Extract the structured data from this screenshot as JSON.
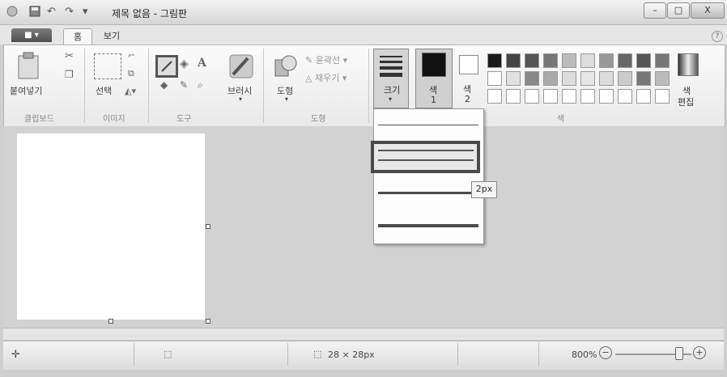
{
  "window": {
    "title": "제목 없음 - 그림판",
    "minimize": "–",
    "maximize": "□",
    "close": "X",
    "qat_undo": "↶",
    "qat_redo": "↷",
    "qat_menu": "▾"
  },
  "tabs": [
    {
      "label": "홈"
    },
    {
      "label": "보기"
    }
  ],
  "file_menu": "■ ▾",
  "help_icon": "?",
  "ribbon": {
    "clipboard": {
      "paste": "붙여넣기",
      "group": "클립보드"
    },
    "image": {
      "select": "선택",
      "group": "이미지"
    },
    "tools": {
      "group": "도구",
      "text_tool": "A"
    },
    "brushes": {
      "label": "브러시"
    },
    "shapes": {
      "label": "도형",
      "outline": "윤곽선",
      "fill": "채우기",
      "group": "도형"
    },
    "size": {
      "label": "크기"
    },
    "color1": {
      "label": "색",
      "num": "1"
    },
    "color2": {
      "label": "색",
      "num": "2"
    },
    "edit_colors": {
      "label1": "색",
      "label2": "편집"
    },
    "colors_group": "색"
  },
  "size_dropdown": {
    "tooltip": "2px",
    "options": [
      "1px",
      "2px",
      "3px",
      "5px"
    ],
    "selected": "2px"
  },
  "status": {
    "canvas_size": "28 × 28px",
    "zoom": "800%",
    "zoom_out": "−",
    "zoom_in": "+"
  },
  "palette_row1": [
    "#1a1a1a",
    "#444444",
    "#555555",
    "#777777",
    "#bbbbbb",
    "#dddddd",
    "#999999",
    "#666666",
    "#555555",
    "#777777"
  ],
  "palette_row2": [
    "#ffffff",
    "#e0e0e0",
    "#888888",
    "#aaaaaa",
    "#dcdcdc",
    "#e6e6e6",
    "#dcdcdc",
    "#cccccc",
    "#777777",
    "#bbbbbb"
  ],
  "palette_row3": [
    "#ffffff",
    "#ffffff",
    "#ffffff",
    "#ffffff",
    "#ffffff",
    "#ffffff",
    "#ffffff",
    "#ffffff",
    "#ffffff",
    "#ffffff"
  ]
}
